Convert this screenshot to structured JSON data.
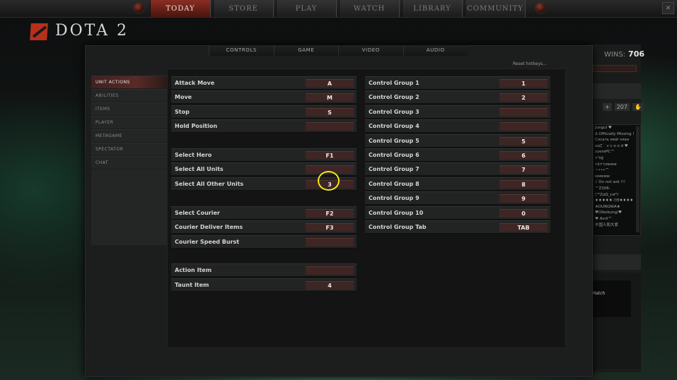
{
  "top_nav": {
    "tabs": [
      "TODAY",
      "STORE",
      "PLAY",
      "WATCH",
      "LIBRARY",
      "COMMUNITY"
    ],
    "active": "TODAY"
  },
  "logo": {
    "text": "DOTA 2"
  },
  "window_buttons": {
    "close": "✕"
  },
  "profile": {
    "wins_label": "WINS:",
    "wins_value": "706"
  },
  "side_controls": {
    "plus": "+",
    "count": "207"
  },
  "chat_lines": [
    "Jungul ♥",
    "Δ Officially Missing !",
    "Сосать мой член",
    "ααζ ` v c o o d ♥",
    "zyerePC™",
    "τ¹ŝģ",
    "τὰτ'ᴄᴍᴇᴡᴡ",
    "~•••™",
    "ᴍᴍᴍᴍᴍ",
    "√ Do not ask !!!",
    "™Z306-",
    "\\ᵀᴹZαΩ_ᴄᴍᴹ/",
    "♦♦♦♦♦-ΞΘ♦♦♦♦",
    "★DURGNIA★",
    "♥Olbokung/♥",
    "♥ Avril™",
    "中国人和大爱"
  ],
  "side_match_label": "Match",
  "settings": {
    "tabs": [
      "CONTROLS",
      "GAME",
      "VIDEO",
      "AUDIO"
    ],
    "reset_label": "Reset hotkeys..."
  },
  "left_menu": [
    "UNIT ACTIONS",
    "ABILITIES",
    "ITEMS",
    "PLAYER",
    "METAGAME",
    "SPECTATOR",
    "CHAT"
  ],
  "hotkeys_left": [
    {
      "label": "Attack Move",
      "key": "A"
    },
    {
      "label": "Move",
      "key": "M"
    },
    {
      "label": "Stop",
      "key": "S"
    },
    {
      "label": "Hold Position",
      "key": ""
    },
    {
      "label": "Select Hero",
      "key": "F1"
    },
    {
      "label": "Select All Units",
      "key": ""
    },
    {
      "label": "Select All Other Units",
      "key": "3"
    },
    {
      "label": "Select Courier",
      "key": "F2"
    },
    {
      "label": "Courier Deliver Items",
      "key": "F3"
    },
    {
      "label": "Courier Speed Burst",
      "key": ""
    },
    {
      "label": "Action Item",
      "key": ""
    },
    {
      "label": "Taunt Item",
      "key": "4"
    }
  ],
  "hotkeys_right": [
    {
      "label": "Control Group 1",
      "key": "1"
    },
    {
      "label": "Control Group 2",
      "key": "2"
    },
    {
      "label": "Control Group 3",
      "key": ""
    },
    {
      "label": "Control Group 4",
      "key": ""
    },
    {
      "label": "Control Group 5",
      "key": "5"
    },
    {
      "label": "Control Group 6",
      "key": "6"
    },
    {
      "label": "Control Group 7",
      "key": "7"
    },
    {
      "label": "Control Group 8",
      "key": "8"
    },
    {
      "label": "Control Group 9",
      "key": "9"
    },
    {
      "label": "Control Group 10",
      "key": "0"
    },
    {
      "label": "Control Group Tab",
      "key": "TAB"
    }
  ],
  "colors": {
    "accent_red": "#8a2e22",
    "key_bg": "#3e2624",
    "highlight": "#f5ea1a"
  }
}
